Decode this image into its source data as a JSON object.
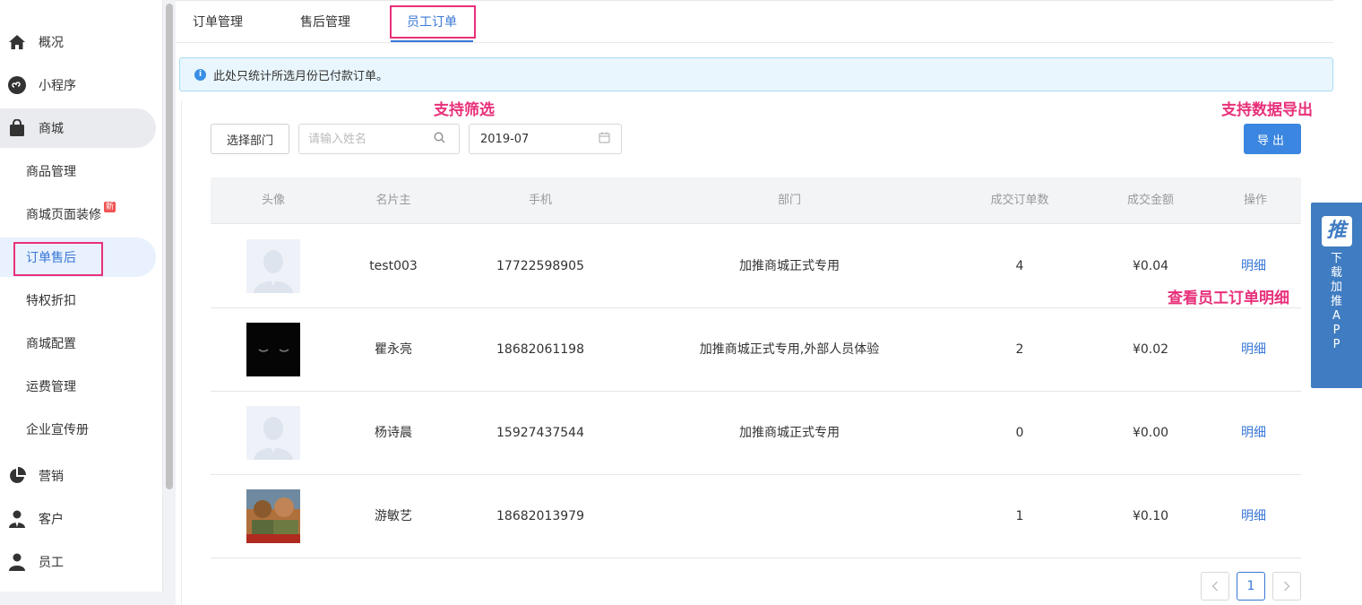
{
  "sidebar": {
    "items": [
      {
        "label": "概况",
        "icon": "home-icon"
      },
      {
        "label": "小程序",
        "icon": "mini-program-icon"
      },
      {
        "label": "商城",
        "icon": "shopping-bag-icon"
      },
      {
        "label": "商品管理"
      },
      {
        "label": "商城页面装修",
        "badge": "新"
      },
      {
        "label": "订单售后"
      },
      {
        "label": "特权折扣"
      },
      {
        "label": "商城配置"
      },
      {
        "label": "运费管理"
      },
      {
        "label": "企业宣传册"
      },
      {
        "label": "营销",
        "icon": "pie-chart-icon"
      },
      {
        "label": "客户",
        "icon": "customer-icon"
      },
      {
        "label": "员工",
        "icon": "user-icon"
      }
    ]
  },
  "tabs": [
    {
      "label": "订单管理"
    },
    {
      "label": "售后管理"
    },
    {
      "label": "员工订单"
    }
  ],
  "alert": {
    "text": "此处只统计所选月份已付款订单。"
  },
  "annotations": {
    "filter": "支持筛选",
    "export": "支持数据导出",
    "detail": "查看员工订单明细"
  },
  "filters": {
    "dept_button": "选择部门",
    "name_placeholder": "请输入姓名",
    "month": "2019-07",
    "export_button": "导出"
  },
  "table": {
    "columns": [
      "头像",
      "名片主",
      "手机",
      "部门",
      "成交订单数",
      "成交金额",
      "操作"
    ],
    "rows": [
      {
        "name": "test003",
        "phone": "17722598905",
        "dept": "加推商城正式专用",
        "orders": "4",
        "amount": "¥0.04",
        "op": "明细"
      },
      {
        "name": "瞿永亮",
        "phone": "18682061198",
        "dept": "加推商城正式专用,外部人员体验",
        "orders": "2",
        "amount": "¥0.02",
        "op": "明细"
      },
      {
        "name": "杨诗晨",
        "phone": "15927437544",
        "dept": "加推商城正式专用",
        "orders": "0",
        "amount": "¥0.00",
        "op": "明细"
      },
      {
        "name": "游敏艺",
        "phone": "18682013979",
        "dept": "",
        "orders": "1",
        "amount": "¥0.10",
        "op": "明细"
      }
    ]
  },
  "pagination": {
    "current": "1"
  },
  "float_app": {
    "logo": "推",
    "text": "下载加推APP"
  },
  "colors": {
    "primary": "#3877d6",
    "highlight": "#e8307a",
    "float": "#3f7cc1"
  }
}
